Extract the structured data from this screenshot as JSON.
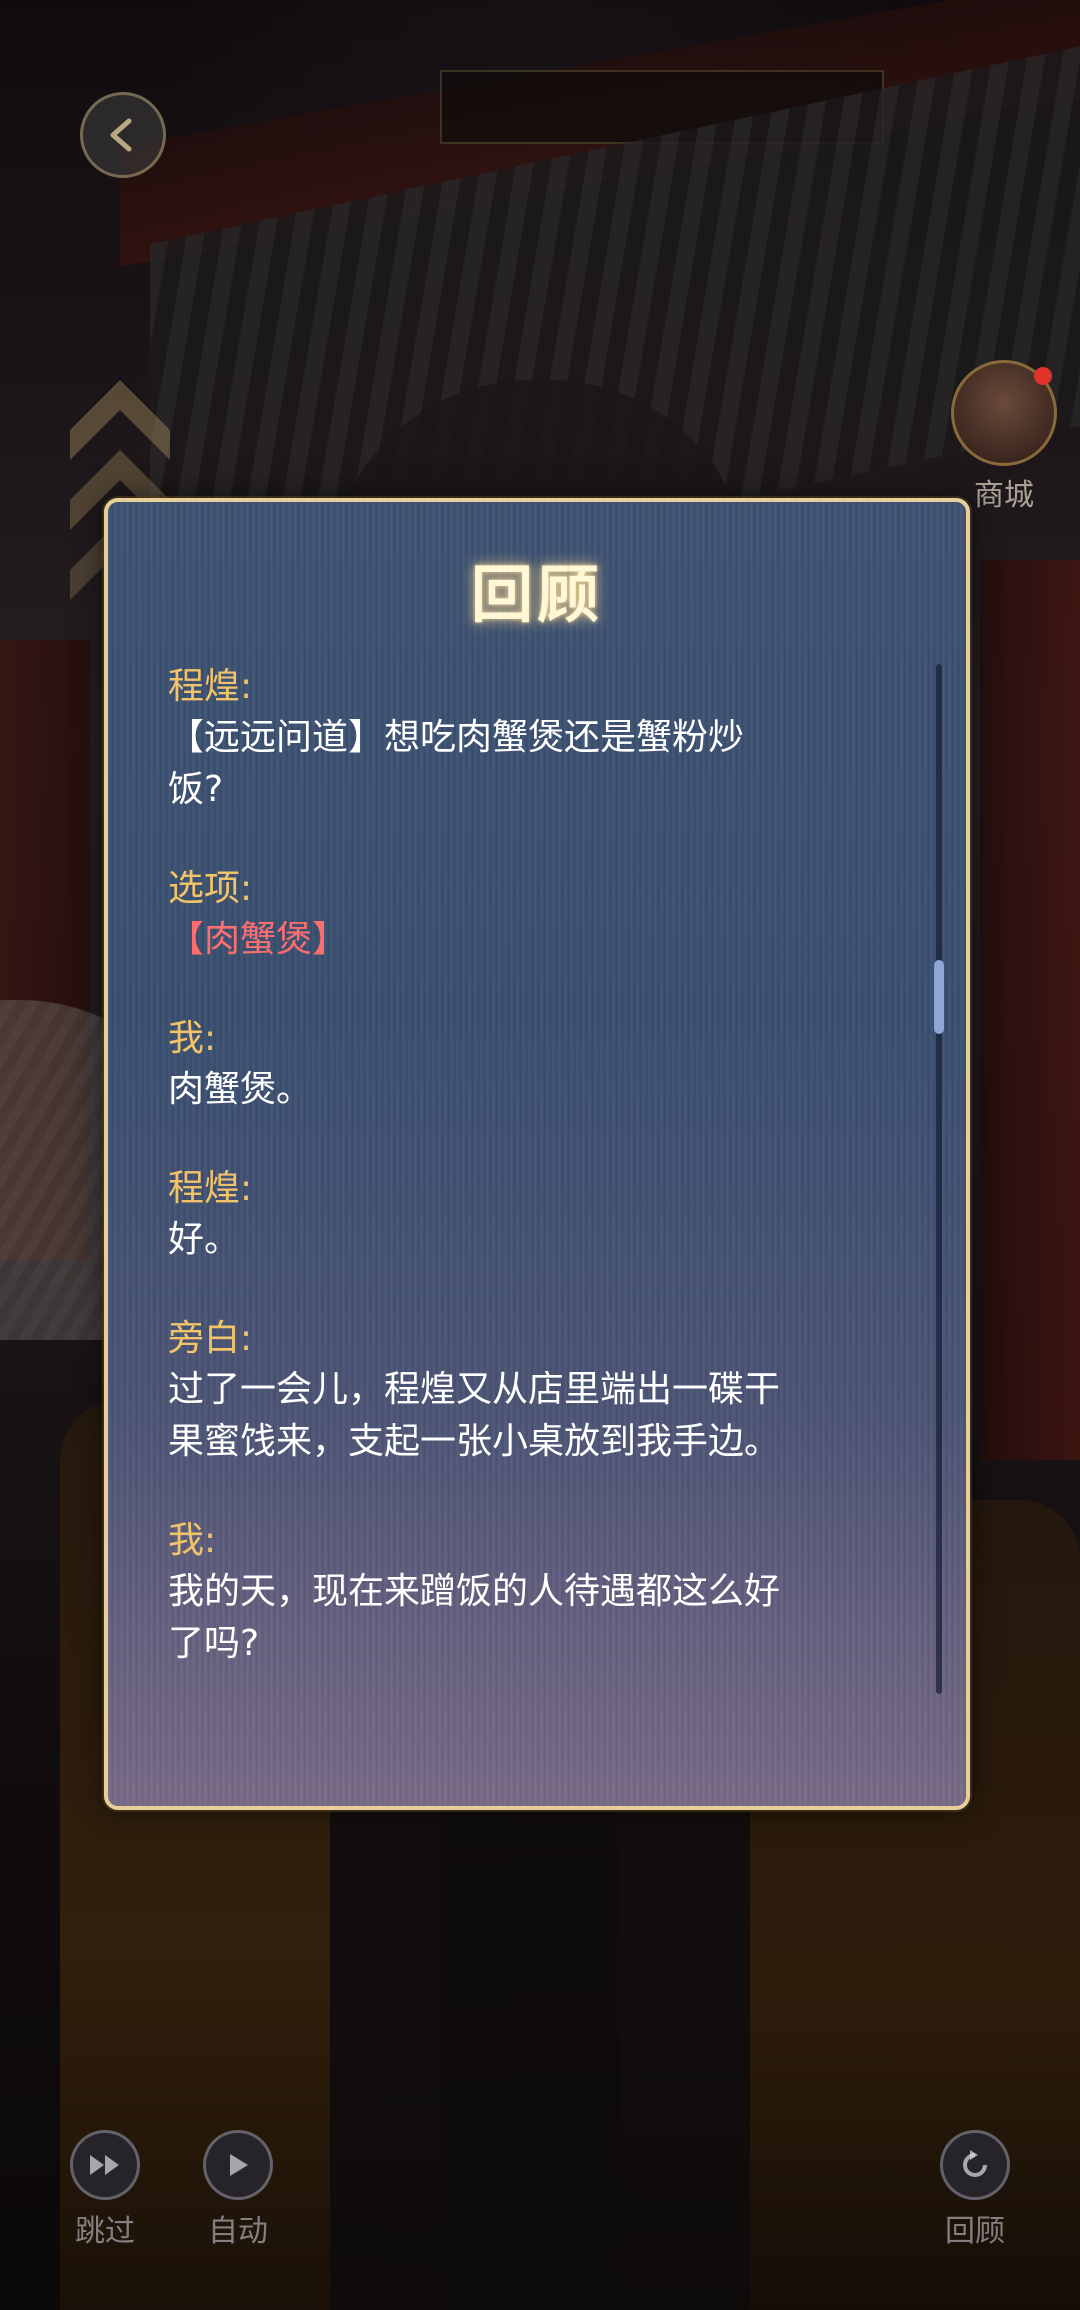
{
  "panel": {
    "title": "回顾"
  },
  "log": [
    {
      "speaker": "程煌:",
      "lines": [
        "【远远问道】想吃肉蟹煲还是蟹粉炒",
        "饭?"
      ]
    },
    {
      "speaker": "选项:",
      "choice": "【肉蟹煲】"
    },
    {
      "speaker": "我:",
      "lines": [
        "肉蟹煲。"
      ]
    },
    {
      "speaker": "程煌:",
      "lines": [
        "好。"
      ]
    },
    {
      "speaker": "旁白:",
      "lines": [
        "过了一会儿，程煌又从店里端出一碟干",
        "果蜜饯来，支起一张小桌放到我手边。"
      ]
    },
    {
      "speaker": "我:",
      "lines": [
        "我的天，现在来蹭饭的人待遇都这么好",
        "了吗?"
      ]
    }
  ],
  "shop": {
    "label": "商城"
  },
  "controls": {
    "skip": {
      "label": "跳过",
      "icon": "fast-forward-icon"
    },
    "auto": {
      "label": "自动",
      "icon": "play-icon"
    },
    "review": {
      "label": "回顾",
      "icon": "review-icon"
    }
  },
  "colors": {
    "speaker": "#f2c46a",
    "choice": "#ff6e6e",
    "panel_border": "#e8cf9a",
    "text": "#ffffff"
  }
}
